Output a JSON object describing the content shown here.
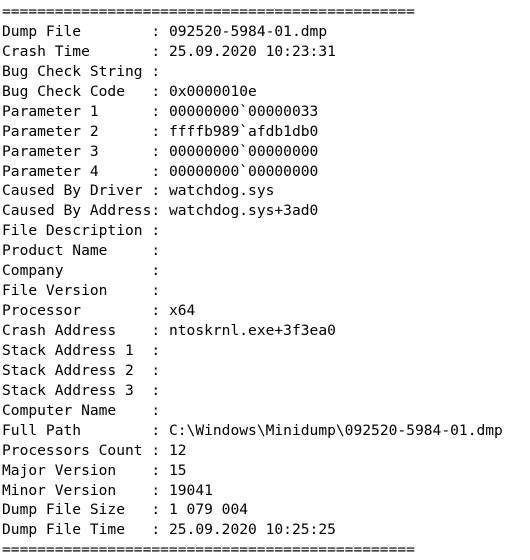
{
  "report": {
    "separator_top": "===============================================",
    "separator_bottom": "===============================================",
    "label_width": 17,
    "colon": ":",
    "rows": [
      {
        "label": "Dump File",
        "value": "092520-5984-01.dmp"
      },
      {
        "label": "Crash Time",
        "value": "25.09.2020 10:23:31"
      },
      {
        "label": "Bug Check String",
        "value": ""
      },
      {
        "label": "Bug Check Code",
        "value": "0x0000010e"
      },
      {
        "label": "Parameter 1",
        "value": "00000000`00000033"
      },
      {
        "label": "Parameter 2",
        "value": "ffffb989`afdb1db0"
      },
      {
        "label": "Parameter 3",
        "value": "00000000`00000000"
      },
      {
        "label": "Parameter 4",
        "value": "00000000`00000000"
      },
      {
        "label": "Caused By Driver",
        "value": "watchdog.sys"
      },
      {
        "label": "Caused By Address",
        "value": "watchdog.sys+3ad0"
      },
      {
        "label": "File Description",
        "value": ""
      },
      {
        "label": "Product Name",
        "value": ""
      },
      {
        "label": "Company",
        "value": ""
      },
      {
        "label": "File Version",
        "value": ""
      },
      {
        "label": "Processor",
        "value": "x64"
      },
      {
        "label": "Crash Address",
        "value": "ntoskrnl.exe+3f3ea0"
      },
      {
        "label": "Stack Address 1",
        "value": ""
      },
      {
        "label": "Stack Address 2",
        "value": ""
      },
      {
        "label": "Stack Address 3",
        "value": ""
      },
      {
        "label": "Computer Name",
        "value": ""
      },
      {
        "label": "Full Path",
        "value": "C:\\Windows\\Minidump\\092520-5984-01.dmp"
      },
      {
        "label": "Processors Count",
        "value": "12"
      },
      {
        "label": "Major Version",
        "value": "15"
      },
      {
        "label": "Minor Version",
        "value": "19041"
      },
      {
        "label": "Dump File Size",
        "value": "1 079 004"
      },
      {
        "label": "Dump File Time",
        "value": "25.09.2020 10:25:25"
      }
    ]
  }
}
